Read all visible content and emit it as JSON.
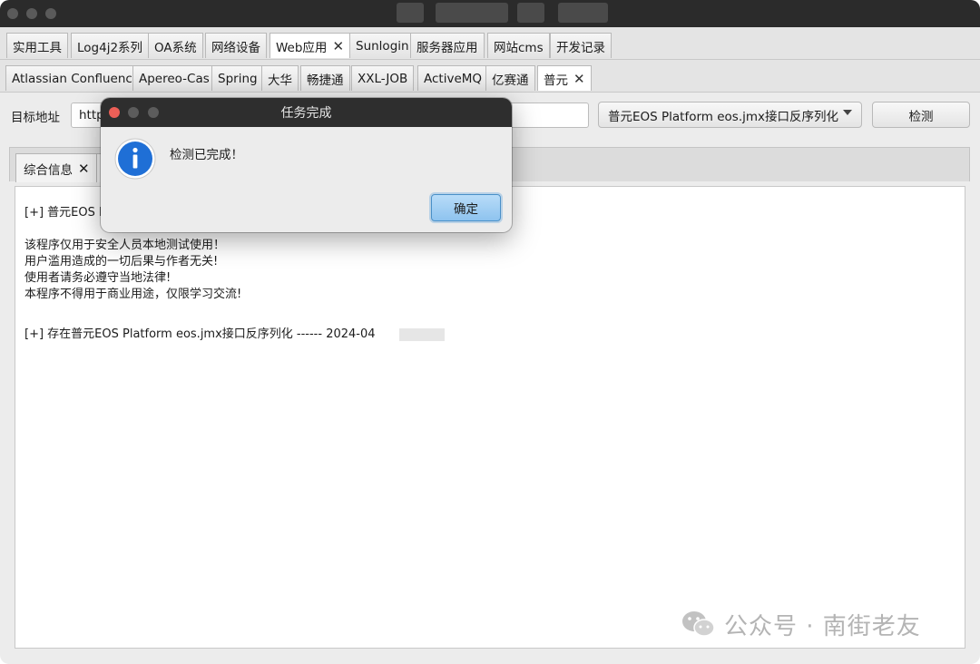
{
  "top_tabs": [
    {
      "label": "实用工具",
      "closable": false,
      "active": false
    },
    {
      "label": "Log4j2系列",
      "closable": false,
      "active": false
    },
    {
      "label": "OA系统",
      "closable": false,
      "active": false
    },
    {
      "label": "网络设备",
      "closable": false,
      "active": false
    },
    {
      "label": "Web应用",
      "closable": true,
      "active": true
    },
    {
      "label": "Sunlogin",
      "closable": false,
      "active": false
    },
    {
      "label": "服务器应用",
      "closable": false,
      "active": false
    },
    {
      "label": "网站cms",
      "closable": false,
      "active": false
    },
    {
      "label": "开发记录",
      "closable": false,
      "active": false
    }
  ],
  "sub_tabs": [
    {
      "label": "Atlassian Confluence",
      "closable": false,
      "active": false
    },
    {
      "label": "Apereo-Cas",
      "closable": false,
      "active": false
    },
    {
      "label": "Spring",
      "closable": false,
      "active": false
    },
    {
      "label": "大华",
      "closable": false,
      "active": false
    },
    {
      "label": "畅捷通",
      "closable": false,
      "active": false
    },
    {
      "label": "XXL-JOB",
      "closable": false,
      "active": false
    },
    {
      "label": "ActiveMQ",
      "closable": false,
      "active": false
    },
    {
      "label": "亿赛通",
      "closable": false,
      "active": false
    },
    {
      "label": "普元",
      "closable": true,
      "active": true
    }
  ],
  "close_glyph": "✕",
  "form": {
    "target_label": "目标地址",
    "url_value": "http",
    "vuln_select": "普元EOS Platform eos.jmx接口反序列化",
    "detect_button": "检测"
  },
  "result_tab": {
    "label": "综合信息"
  },
  "output_lines": [
    "[+] 普元EOS P",
    "",
    "该程序仅用于安全人员本地测试使用！",
    "用户滥用造成的一切后果与作者无关!",
    "使用者请务必遵守当地法律!",
    "本程序不得用于商业用途，仅限学习交流!",
    "",
    "[+] 存在普元EOS Platform eos.jmx接口反序列化 ------ 2024-04"
  ],
  "dialog": {
    "title": "任务完成",
    "message": "检测已完成！",
    "icon": "info-icon",
    "ok_button": "确定"
  },
  "watermark": {
    "text": "公众号 · 南街老友",
    "icon": "wechat-icon"
  },
  "colors": {
    "dialog_button": "#8ec3ef",
    "info_blue": "#1f6fd6",
    "close_red": "#ec5f57"
  }
}
